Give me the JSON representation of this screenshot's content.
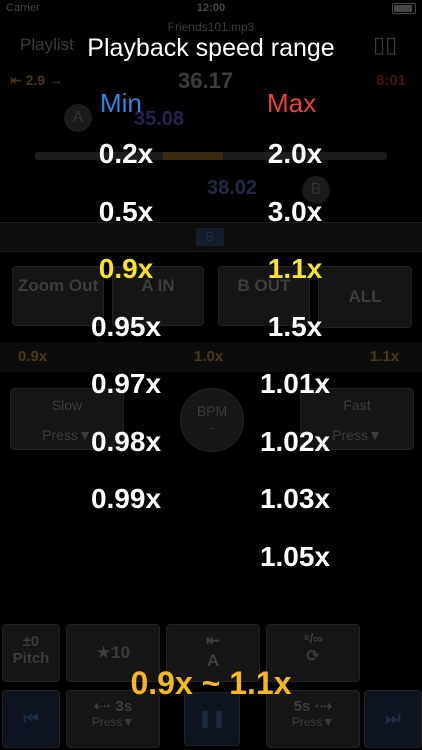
{
  "status_bar": {
    "carrier": "Carrier",
    "time": "12:00"
  },
  "background": {
    "file_name": "Friends101.mp3",
    "playlist_label": "Playlist",
    "pitch_left": "⇤ 2.9 →",
    "position_main": "36.17",
    "duration": "8:01",
    "point_a": "35.08",
    "point_b": "38.02",
    "marker_a": "A",
    "marker_b": "B",
    "bar_b": "B",
    "zoom_out": "Zoom Out",
    "a_in": "A IN",
    "b_out": "B OUT",
    "all": "ALL",
    "speed_left": "0.9x",
    "speed_center": "1.0x",
    "speed_right": "1.1x",
    "slow": "Slow",
    "slow_press": "Press▼",
    "bpm": "BPM",
    "bpm_value": "-",
    "fast": "Fast",
    "fast_press": "Press▼",
    "pitch_btn_top": "±0",
    "pitch_btn_bottom": "Pitch",
    "star_btn": "★10",
    "a_btn_top": "⇤",
    "a_btn_bottom": "A",
    "loop_btn_top": "⁸/∞",
    "rewind_btn_top": "⇠· 3s",
    "rewind_btn_bottom": "Press▼",
    "forward_btn_top": "5s ·⇢",
    "forward_btn_bottom": "Press▼"
  },
  "overlay": {
    "title": "Playback speed range",
    "min_header": "Min",
    "max_header": "Max",
    "min_options": [
      "0.2x",
      "0.5x",
      "0.9x",
      "0.95x",
      "0.97x",
      "0.98x",
      "0.99x"
    ],
    "max_options": [
      "2.0x",
      "3.0x",
      "1.1x",
      "1.5x",
      "1.01x",
      "1.02x",
      "1.03x",
      "1.05x"
    ],
    "selected_min": "0.9x",
    "selected_max": "1.1x",
    "selected_range": "0.9x ~ 1.1x",
    "colors": {
      "min_header": "#2e86de",
      "max_header": "#e8423a",
      "selected": "#f7e32a",
      "range": "#f5b820"
    }
  }
}
